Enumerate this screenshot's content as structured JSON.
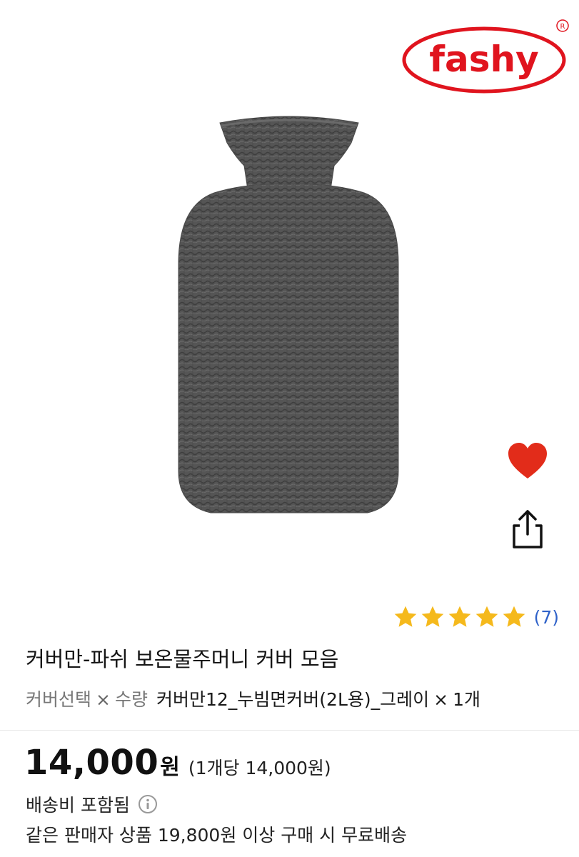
{
  "brand": {
    "logo_text": "fashy",
    "registered_mark": "R",
    "logo_color": "#e0141e"
  },
  "product_image": {
    "description_icon": "hot-water-bottle-image",
    "cover_color": "#555555"
  },
  "actions": {
    "wish_icon": "heart-icon",
    "wish_color": "#e22c1a",
    "share_icon": "share-icon"
  },
  "rating": {
    "stars": 5,
    "max_stars": 5,
    "star_color": "#f5b91c",
    "review_count": "(7)"
  },
  "title": "커버만-파쉬 보온물주머니 커버 모음",
  "options": {
    "label_cover": "커버선택",
    "label_sep": "×",
    "label_qty": "수량",
    "selected_cover": "커버만12_누빔면커버(2L용)_그레이",
    "selected_sep": "×",
    "selected_qty": "1개"
  },
  "price": {
    "amount": "14,000",
    "currency": "원",
    "unit_price": "(1개당 14,000원)"
  },
  "shipping": {
    "included": "배송비 포함됨",
    "info_icon": "info-icon",
    "free_condition": "같은 판매자 상품 19,800원 이상 구매 시 무료배송"
  }
}
